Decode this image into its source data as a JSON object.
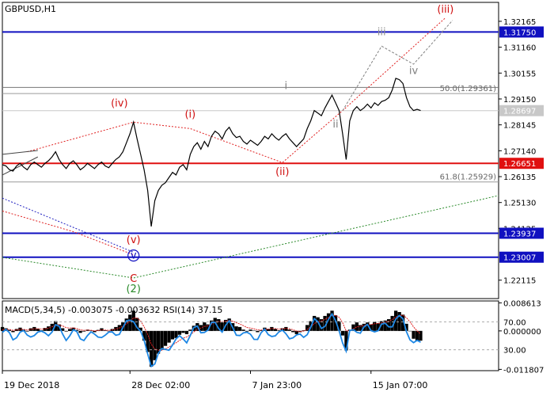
{
  "chart_data": {
    "type": "line",
    "title": "GBPUSD,H1",
    "price_axis": {
      "ylim": [
        1.214,
        1.329
      ],
      "ticks": [
        1.32165,
        1.3116,
        1.30155,
        1.2915,
        1.28145,
        1.2714,
        1.26135,
        1.2513,
        1.24125,
        1.22115
      ]
    },
    "time_axis": {
      "labels": [
        "19 Dec 2018",
        "28 Dec 02:00",
        "7 Jan 23:00",
        "15 Jan 07:00"
      ],
      "label_positions": [
        0.0,
        36.0,
        70.0,
        104.0
      ]
    },
    "levels": [
      {
        "value": 1.3175,
        "label": "1.31750",
        "color": "#1010c0"
      },
      {
        "value": 1.26651,
        "label": "1.26651",
        "color": "#e01010"
      },
      {
        "value": 1.23937,
        "label": "1.23937",
        "color": "#1010c0"
      },
      {
        "value": 1.23007,
        "label": "1.23007",
        "color": "#1010c0"
      }
    ],
    "current_price": {
      "value": 1.28697,
      "label": "1.28697"
    },
    "fibonacci": [
      {
        "value": 1.29361,
        "label": "50.0(1.29361)"
      },
      {
        "value": 1.25929,
        "label": "61.8(1.25929)"
      }
    ],
    "price_series": [
      [
        0,
        1.266
      ],
      [
        1,
        1.2655
      ],
      [
        2,
        1.264
      ],
      [
        3,
        1.2635
      ],
      [
        4,
        1.2655
      ],
      [
        5,
        1.2665
      ],
      [
        6,
        1.265
      ],
      [
        7,
        1.264
      ],
      [
        8,
        1.266
      ],
      [
        9,
        1.267
      ],
      [
        10,
        1.266
      ],
      [
        11,
        1.265
      ],
      [
        12,
        1.2665
      ],
      [
        13,
        1.2675
      ],
      [
        14,
        1.269
      ],
      [
        15,
        1.271
      ],
      [
        16,
        1.268
      ],
      [
        17,
        1.266
      ],
      [
        18,
        1.2645
      ],
      [
        19,
        1.2665
      ],
      [
        20,
        1.2675
      ],
      [
        21,
        1.266
      ],
      [
        22,
        1.264
      ],
      [
        23,
        1.265
      ],
      [
        24,
        1.2665
      ],
      [
        25,
        1.2655
      ],
      [
        26,
        1.2645
      ],
      [
        27,
        1.266
      ],
      [
        28,
        1.267
      ],
      [
        29,
        1.2655
      ],
      [
        30,
        1.2648
      ],
      [
        31,
        1.2665
      ],
      [
        32,
        1.268
      ],
      [
        33,
        1.269
      ],
      [
        34,
        1.271
      ],
      [
        35,
        1.2745
      ],
      [
        36,
        1.278
      ],
      [
        37,
        1.2825
      ],
      [
        38,
        1.276
      ],
      [
        39,
        1.27
      ],
      [
        40,
        1.264
      ],
      [
        41,
        1.256
      ],
      [
        42,
        1.242
      ],
      [
        43,
        1.252
      ],
      [
        44,
        1.256
      ],
      [
        45,
        1.258
      ],
      [
        46,
        1.259
      ],
      [
        47,
        1.261
      ],
      [
        48,
        1.263
      ],
      [
        49,
        1.262
      ],
      [
        50,
        1.265
      ],
      [
        51,
        1.266
      ],
      [
        52,
        1.264
      ],
      [
        53,
        1.27
      ],
      [
        54,
        1.273
      ],
      [
        55,
        1.2745
      ],
      [
        56,
        1.272
      ],
      [
        57,
        1.275
      ],
      [
        58,
        1.273
      ],
      [
        59,
        1.277
      ],
      [
        60,
        1.279
      ],
      [
        61,
        1.278
      ],
      [
        62,
        1.276
      ],
      [
        63,
        1.279
      ],
      [
        64,
        1.2805
      ],
      [
        65,
        1.278
      ],
      [
        66,
        1.2765
      ],
      [
        67,
        1.277
      ],
      [
        68,
        1.275
      ],
      [
        69,
        1.274
      ],
      [
        70,
        1.2755
      ],
      [
        71,
        1.2745
      ],
      [
        72,
        1.2735
      ],
      [
        73,
        1.275
      ],
      [
        74,
        1.277
      ],
      [
        75,
        1.276
      ],
      [
        76,
        1.278
      ],
      [
        77,
        1.2765
      ],
      [
        78,
        1.2755
      ],
      [
        79,
        1.277
      ],
      [
        80,
        1.278
      ],
      [
        81,
        1.276
      ],
      [
        82,
        1.2745
      ],
      [
        83,
        1.273
      ],
      [
        84,
        1.2745
      ],
      [
        85,
        1.276
      ],
      [
        86,
        1.28
      ],
      [
        87,
        1.283
      ],
      [
        88,
        1.287
      ],
      [
        89,
        1.286
      ],
      [
        90,
        1.285
      ],
      [
        91,
        1.288
      ],
      [
        92,
        1.2905
      ],
      [
        93,
        1.293
      ],
      [
        94,
        1.29
      ],
      [
        95,
        1.287
      ],
      [
        96,
        1.278
      ],
      [
        97,
        1.268
      ],
      [
        98,
        1.283
      ],
      [
        99,
        1.287
      ],
      [
        100,
        1.2885
      ],
      [
        101,
        1.287
      ],
      [
        102,
        1.288
      ],
      [
        103,
        1.2895
      ],
      [
        104,
        1.288
      ],
      [
        105,
        1.29
      ],
      [
        106,
        1.289
      ],
      [
        107,
        1.2905
      ],
      [
        108,
        1.291
      ],
      [
        109,
        1.292
      ],
      [
        110,
        1.295
      ],
      [
        111,
        1.2995
      ],
      [
        112,
        1.299
      ],
      [
        113,
        1.2975
      ],
      [
        114,
        1.292
      ],
      [
        115,
        1.2885
      ],
      [
        116,
        1.287
      ],
      [
        117,
        1.2875
      ],
      [
        118,
        1.287
      ]
    ],
    "wave_labels": [
      {
        "text": "(iii)",
        "x": 125,
        "y": 1.325,
        "color": "#d01010"
      },
      {
        "text": "iii",
        "x": 107,
        "y": 1.3162,
        "color": "#909090"
      },
      {
        "text": "iv",
        "x": 116,
        "y": 1.3012,
        "color": "#808080"
      },
      {
        "text": "i",
        "x": 80,
        "y": 1.2954,
        "color": "#808080"
      },
      {
        "text": "ii",
        "x": 94,
        "y": 1.2804,
        "color": "#808080"
      },
      {
        "text": "(iv)",
        "x": 33,
        "y": 1.2885,
        "color": "#d01010"
      },
      {
        "text": "(i)",
        "x": 53,
        "y": 1.2842,
        "color": "#d01010"
      },
      {
        "text": "(ii)",
        "x": 79,
        "y": 1.2619,
        "color": "#d01010"
      },
      {
        "text": "(v)",
        "x": 37,
        "y": 1.2355,
        "color": "#d01010"
      },
      {
        "text": "v",
        "x": 37,
        "y": 1.2295,
        "color": "#1010c0",
        "circled": true
      },
      {
        "text": "C",
        "x": 37,
        "y": 1.2205,
        "color": "#d01010"
      },
      {
        "text": "(2)",
        "x": 37,
        "y": 1.2165,
        "color": "#2a8a2a"
      }
    ],
    "macd": {
      "title": "MACD(5,34,5) -0.003075 -0.003632 RSI(14) 37.15",
      "ylim": [
        -0.0122,
        0.0092
      ],
      "ticks": [
        0.008613,
        0.0,
        -0.011807
      ],
      "tick_labels": [
        "0.008613",
        "0.000000",
        "-0.011807"
      ],
      "rsi_levels": [
        {
          "value": 70,
          "label": "70.00"
        },
        {
          "value": 30,
          "label": "30.00"
        }
      ],
      "histogram": [
        0.0012,
        0.0008,
        0.0003,
        -0.0004,
        0.0006,
        0.001,
        0.0004,
        -0.0002,
        0.0008,
        0.0012,
        0.0007,
        0.0002,
        0.0009,
        0.0014,
        0.0022,
        0.003,
        0.002,
        0.0008,
        -0.0002,
        0.0006,
        0.001,
        0.0003,
        -0.0006,
        -0.0002,
        0.0004,
        0.0001,
        -0.0004,
        0.0003,
        0.0008,
        0.0002,
        -0.0001,
        0.0006,
        0.0012,
        0.0018,
        0.0026,
        0.0038,
        0.005,
        0.0062,
        0.004,
        0.001,
        -0.003,
        -0.0065,
        -0.011,
        -0.009,
        -0.007,
        -0.0058,
        -0.0046,
        -0.0036,
        -0.0026,
        -0.0022,
        -0.0012,
        -0.0006,
        -0.001,
        0.0004,
        0.0016,
        0.0024,
        0.0018,
        0.0026,
        0.002,
        0.0032,
        0.004,
        0.0036,
        0.0026,
        0.0034,
        0.0038,
        0.0024,
        0.0014,
        0.0012,
        0.0004,
        -0.0002,
        0.0004,
        0.0001,
        -0.0004,
        0.0002,
        0.001,
        0.0006,
        0.0012,
        0.0006,
        0.0002,
        0.0008,
        0.0012,
        0.0004,
        -0.0004,
        -0.001,
        -0.0004,
        0.0002,
        0.0018,
        0.003,
        0.0046,
        0.0042,
        0.0036,
        0.0046,
        0.0054,
        0.0062,
        0.0048,
        0.003,
        -0.0014,
        -0.006,
        0.0004,
        0.002,
        0.0026,
        0.0018,
        0.0022,
        0.0026,
        0.002,
        0.0028,
        0.0024,
        0.003,
        0.0032,
        0.0036,
        0.0046,
        0.0062,
        0.0058,
        0.005,
        0.0022,
        0.0,
        -0.0024,
        -0.003,
        -0.003
      ]
    }
  }
}
